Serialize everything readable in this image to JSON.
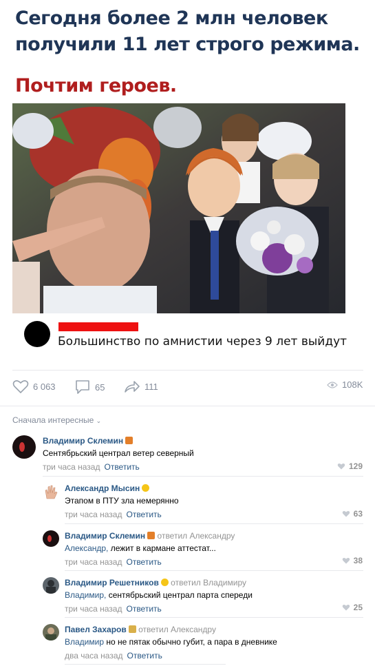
{
  "meme": {
    "title": "Сегодня более 2 млн человек получили 11 лет строго режима.",
    "subtitle": "Почтим героев.",
    "comment_text": "Большинство по амнистии через 9 лет выйдут"
  },
  "post_actions": {
    "likes": "6 063",
    "comments": "65",
    "shares": "111",
    "views": "108K"
  },
  "sort_label": "Сначала интересные",
  "comments": [
    {
      "author": "Владимир Склемин",
      "reply_to": "",
      "text": "Сентябрьский централ ветер северный",
      "addr": "",
      "time": "три часа назад",
      "reply": "Ответить",
      "likes": "129"
    },
    {
      "author": "Александр Мысин",
      "reply_to": "",
      "text": "Этапом в ПТУ зла немерянно",
      "addr": "",
      "time": "три часа назад",
      "reply": "Ответить",
      "likes": "63"
    },
    {
      "author": "Владимир Склемин",
      "reply_to": "ответил Александру",
      "text": " лежит в кармане аттестат...",
      "addr": "Александр,",
      "time": "три часа назад",
      "reply": "Ответить",
      "likes": "38"
    },
    {
      "author": "Владимир Решетников",
      "reply_to": "ответил Владимиру",
      "text": " сентябрьский централ парта спереди",
      "addr": "Владимир,",
      "time": "три часа назад",
      "reply": "Ответить",
      "likes": "25"
    },
    {
      "author": "Павел Захаров",
      "reply_to": "ответил Александру",
      "text": " но не пятак обычно губит, а пара в дневнике",
      "addr": "Владимир",
      "time": "два часа назад",
      "reply": "Ответить",
      "likes": ""
    }
  ],
  "colors": {
    "title": "#1f3556",
    "subtitle": "#b01e1e",
    "link": "#2a5885",
    "muted": "#939393"
  }
}
